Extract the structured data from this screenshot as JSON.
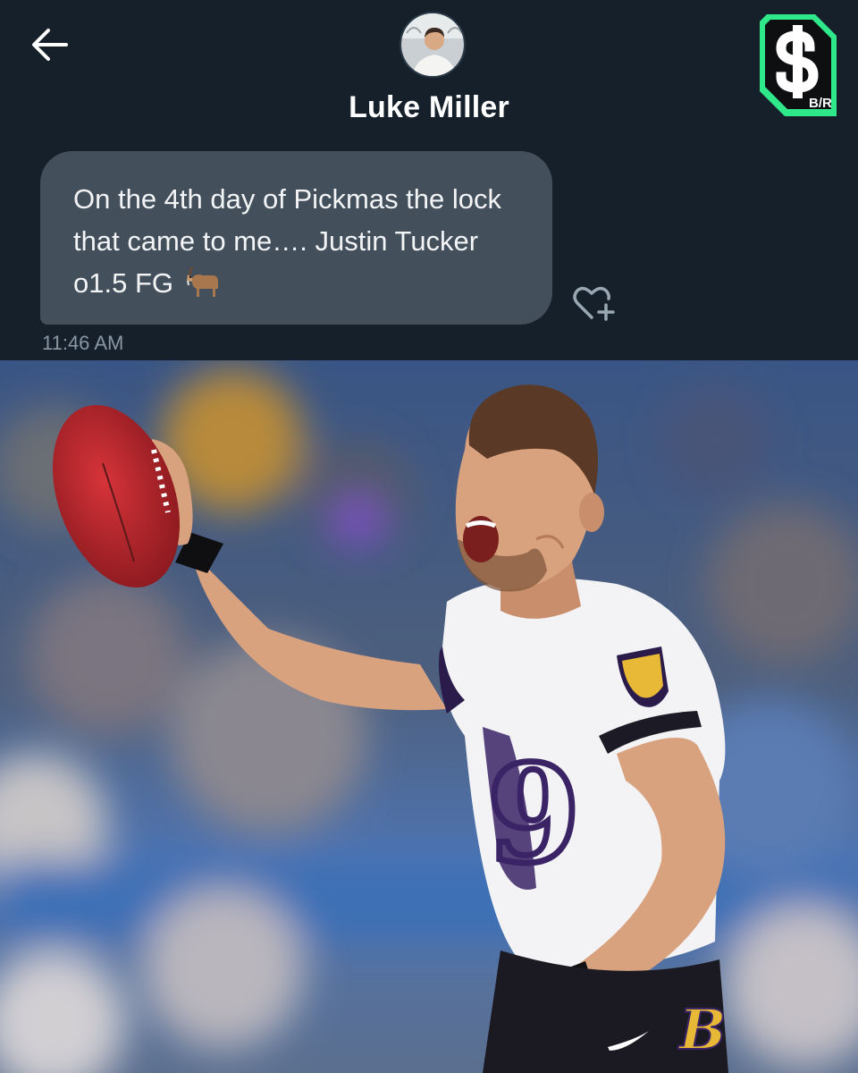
{
  "header": {
    "contact_name": "Luke Miller",
    "back_icon": "arrow-left-icon",
    "brand": {
      "logo_icon": "br-betting-dollar-icon",
      "text": "B/R",
      "accent": "#2ee88a"
    }
  },
  "message": {
    "text": "On the 4th day of Pickmas the lock that came to me…. Justin Tucker o1.5 FG",
    "emoji": "goat",
    "time": "11:46 AM",
    "reaction_icon": "heart-plus-icon"
  },
  "photo": {
    "subject": "football-player-celebrating",
    "jersey_number": "9",
    "colors": {
      "jersey": "#f3f2f5",
      "trim": "#2a1b4a",
      "ball": "#b8282d",
      "background": "#3d5f93"
    }
  }
}
